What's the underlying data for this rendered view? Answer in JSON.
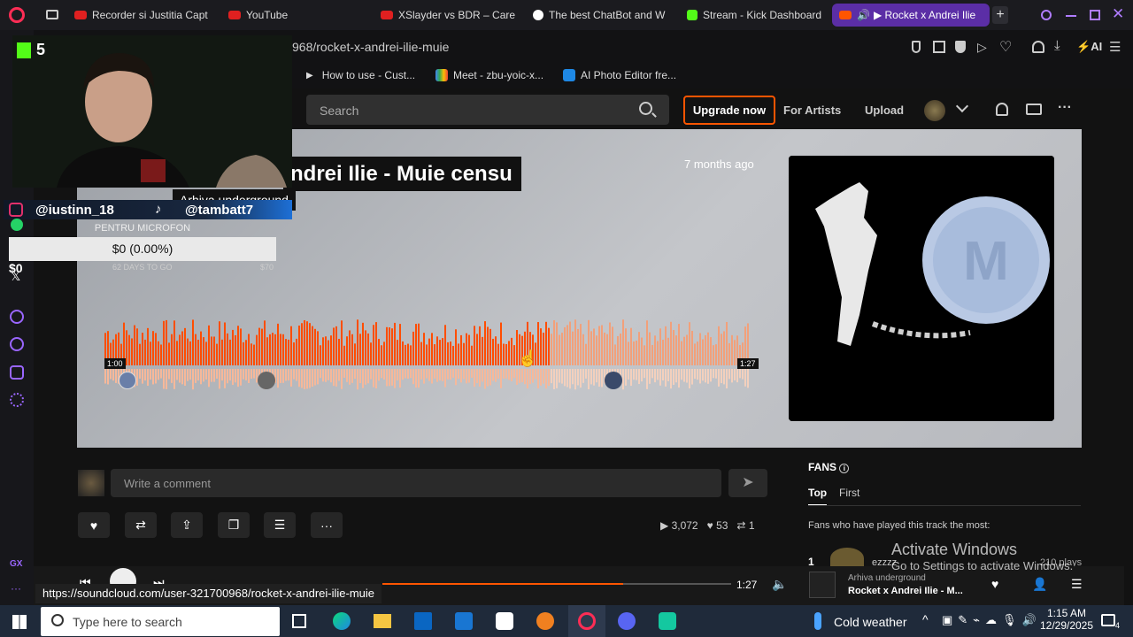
{
  "browser": {
    "tabs": [
      {
        "label": "Recorder si Justitia Capt",
        "color": "#e02020"
      },
      {
        "label": "YouTube",
        "color": "#e02020"
      },
      {
        "label": "XSlayder vs BDR – Care",
        "color": "#e02020"
      },
      {
        "label": "The best ChatBot and W",
        "color": "#ffffff"
      },
      {
        "label": "Stream - Kick Dashboard",
        "color": "#53fc18"
      },
      {
        "label": "▶ Rocket x Andrei Ilie",
        "color": "#ff5500"
      }
    ],
    "url": "968/rocket-x-andrei-ilie-muie",
    "bookmarks": [
      {
        "label": "How to use - Cust...",
        "color": "#cccccc"
      },
      {
        "label": "Meet - zbu-yoic-x...",
        "color": "#34a853"
      },
      {
        "label": "AI Photo Editor fre...",
        "color": "#1e88e5"
      }
    ],
    "ai_label": "AI"
  },
  "soundcloud": {
    "search_placeholder": "Search",
    "upgrade_label": "Upgrade now",
    "for_artists": "For Artists",
    "upload": "Upload",
    "track_title": "ndrei Ilie - Muie censu",
    "artist": "Arhiva underground",
    "posted": "7 months ago",
    "time_current": "1:00",
    "time_total": "1:27",
    "progress": 0.69,
    "comment_placeholder": "Write a comment",
    "stats": {
      "plays": "3,072",
      "likes": "53",
      "reposts": "1"
    },
    "fans_title": "FANS",
    "fans_tabs": [
      "Top",
      "First"
    ],
    "fans_desc": "Fans who have played this track the most:",
    "fan_rank": "1",
    "fan_plays": "210 plays",
    "fan_name": "ezzzz"
  },
  "player": {
    "time_total": "1:27",
    "now_artist": "Arhiva underground",
    "now_title": "Rocket x Andrei Ilie - M..."
  },
  "status_url": "https://soundcloud.com/user-321700968/rocket-x-andrei-ilie-muie",
  "overlay": {
    "kick_count": "5",
    "instagram": "@iustinn_18",
    "tiktok": "@tambatt7",
    "goal_title": "PENTRU MICROFON",
    "goal_value": "$0 (0.00%)",
    "goal_days": "62 DAYS TO GO",
    "goal_target": "$70",
    "side_amount": "$0"
  },
  "watermark": {
    "line1": "Activate Windows",
    "line2": "Go to Settings to activate Windows."
  },
  "taskbar": {
    "search_placeholder": "Type here to search",
    "weather": "Cold weather",
    "time": "1:15 AM",
    "date": "12/29/2025",
    "notif_count": "4"
  }
}
